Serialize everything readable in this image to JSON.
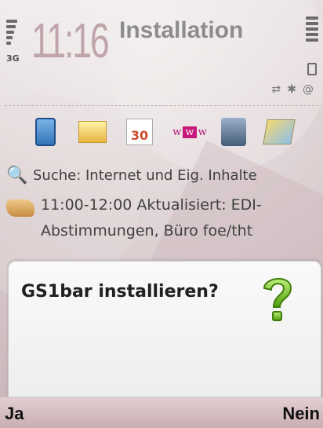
{
  "status": {
    "network": "3G",
    "time": "11:16",
    "app_title": "Installation",
    "icons": [
      "usb-icon",
      "bluetooth-icon",
      "email-at-icon"
    ]
  },
  "shortcuts": [
    {
      "name": "contacts-icon"
    },
    {
      "name": "messaging-icon"
    },
    {
      "name": "calendar-icon",
      "label": "30"
    },
    {
      "name": "web-icon",
      "label": "www"
    },
    {
      "name": "app-manager-icon"
    },
    {
      "name": "maps-icon"
    }
  ],
  "search": {
    "text": "Suche: Internet und Eig. Inhalte"
  },
  "calendar_entry": {
    "line1": "11:00-12:00 Aktualisiert: EDI-",
    "line2": "Abstimmungen, Büro foe/tht"
  },
  "dialog": {
    "question": "GS1bar installieren?"
  },
  "softkeys": {
    "left": "Ja",
    "right": "Nein"
  },
  "colors": {
    "clock": "#bfa5ab",
    "question_green": "#6cc01a",
    "softkey_bg": "#c9adb3"
  }
}
